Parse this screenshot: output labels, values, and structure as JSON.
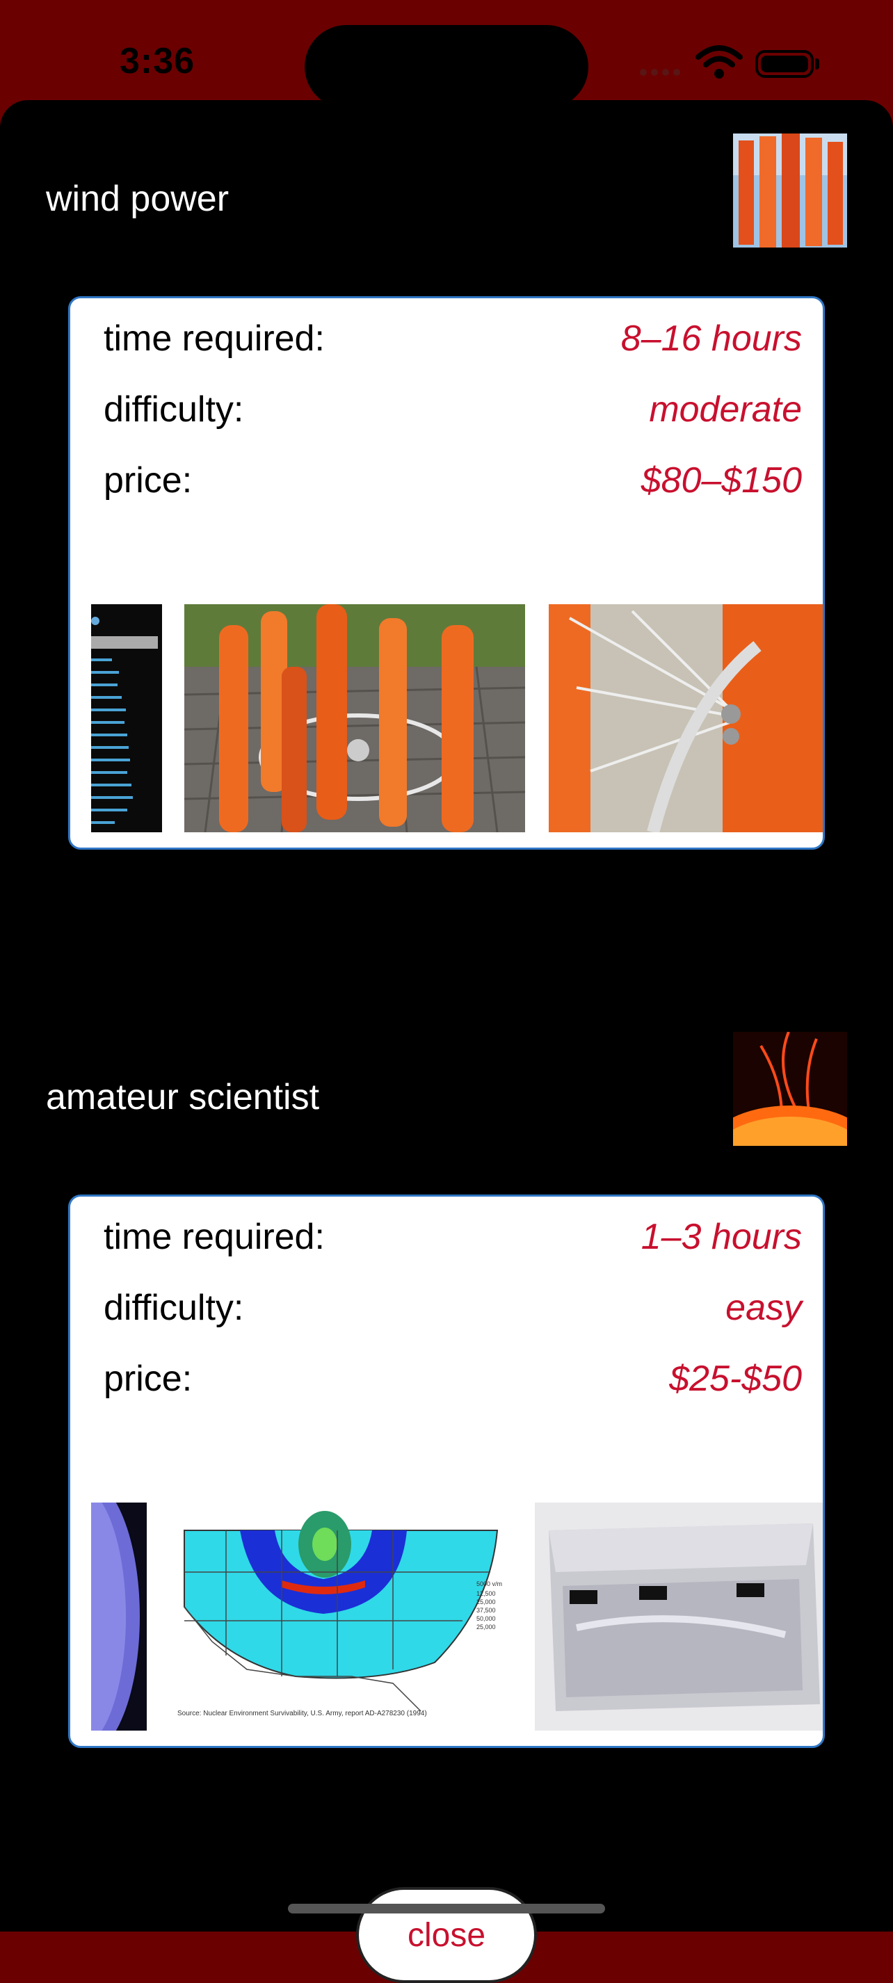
{
  "status_bar": {
    "time": "3:36"
  },
  "sections": [
    {
      "title": "wind power",
      "rows": [
        {
          "label": "time required:",
          "value": "8–16 hours"
        },
        {
          "label": "difficulty:",
          "value": "moderate"
        },
        {
          "label": "price:",
          "value": "$80–$150"
        }
      ]
    },
    {
      "title": "amateur scientist",
      "rows": [
        {
          "label": "time required:",
          "value": "1–3 hours"
        },
        {
          "label": "difficulty:",
          "value": "easy"
        },
        {
          "label": "price:",
          "value": "$25-$50"
        }
      ]
    }
  ],
  "map_caption": "Source: Nuclear Environment Survivability, U.S. Army, report AD-A278230 (1994)",
  "close_button": {
    "label": "close"
  },
  "colors": {
    "accent": "#c8102e",
    "card_border": "#2f77c6",
    "status_bg": "#6b0000"
  },
  "icons": [
    "wifi-icon",
    "battery-icon",
    "cellular-signal-icon"
  ]
}
